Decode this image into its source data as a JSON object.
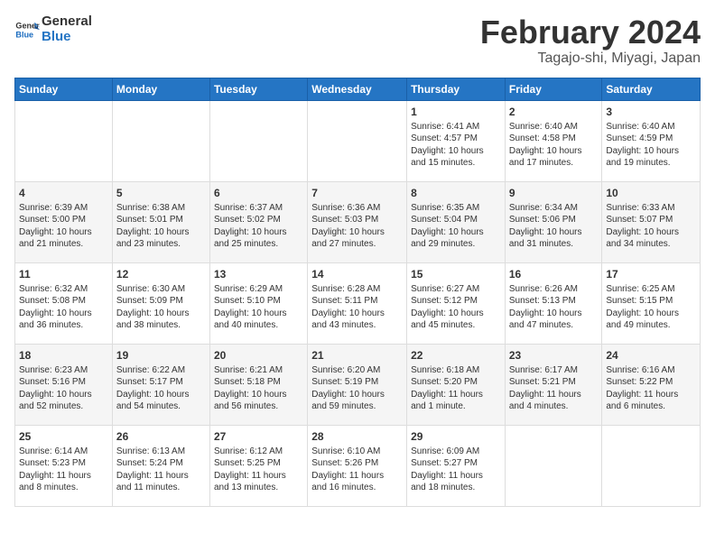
{
  "header": {
    "logo_line1": "General",
    "logo_line2": "Blue",
    "month_title": "February 2024",
    "subtitle": "Tagajo-shi, Miyagi, Japan"
  },
  "weekdays": [
    "Sunday",
    "Monday",
    "Tuesday",
    "Wednesday",
    "Thursday",
    "Friday",
    "Saturday"
  ],
  "weeks": [
    [
      {
        "day": "",
        "info": ""
      },
      {
        "day": "",
        "info": ""
      },
      {
        "day": "",
        "info": ""
      },
      {
        "day": "",
        "info": ""
      },
      {
        "day": "1",
        "info": "Sunrise: 6:41 AM\nSunset: 4:57 PM\nDaylight: 10 hours\nand 15 minutes."
      },
      {
        "day": "2",
        "info": "Sunrise: 6:40 AM\nSunset: 4:58 PM\nDaylight: 10 hours\nand 17 minutes."
      },
      {
        "day": "3",
        "info": "Sunrise: 6:40 AM\nSunset: 4:59 PM\nDaylight: 10 hours\nand 19 minutes."
      }
    ],
    [
      {
        "day": "4",
        "info": "Sunrise: 6:39 AM\nSunset: 5:00 PM\nDaylight: 10 hours\nand 21 minutes."
      },
      {
        "day": "5",
        "info": "Sunrise: 6:38 AM\nSunset: 5:01 PM\nDaylight: 10 hours\nand 23 minutes."
      },
      {
        "day": "6",
        "info": "Sunrise: 6:37 AM\nSunset: 5:02 PM\nDaylight: 10 hours\nand 25 minutes."
      },
      {
        "day": "7",
        "info": "Sunrise: 6:36 AM\nSunset: 5:03 PM\nDaylight: 10 hours\nand 27 minutes."
      },
      {
        "day": "8",
        "info": "Sunrise: 6:35 AM\nSunset: 5:04 PM\nDaylight: 10 hours\nand 29 minutes."
      },
      {
        "day": "9",
        "info": "Sunrise: 6:34 AM\nSunset: 5:06 PM\nDaylight: 10 hours\nand 31 minutes."
      },
      {
        "day": "10",
        "info": "Sunrise: 6:33 AM\nSunset: 5:07 PM\nDaylight: 10 hours\nand 34 minutes."
      }
    ],
    [
      {
        "day": "11",
        "info": "Sunrise: 6:32 AM\nSunset: 5:08 PM\nDaylight: 10 hours\nand 36 minutes."
      },
      {
        "day": "12",
        "info": "Sunrise: 6:30 AM\nSunset: 5:09 PM\nDaylight: 10 hours\nand 38 minutes."
      },
      {
        "day": "13",
        "info": "Sunrise: 6:29 AM\nSunset: 5:10 PM\nDaylight: 10 hours\nand 40 minutes."
      },
      {
        "day": "14",
        "info": "Sunrise: 6:28 AM\nSunset: 5:11 PM\nDaylight: 10 hours\nand 43 minutes."
      },
      {
        "day": "15",
        "info": "Sunrise: 6:27 AM\nSunset: 5:12 PM\nDaylight: 10 hours\nand 45 minutes."
      },
      {
        "day": "16",
        "info": "Sunrise: 6:26 AM\nSunset: 5:13 PM\nDaylight: 10 hours\nand 47 minutes."
      },
      {
        "day": "17",
        "info": "Sunrise: 6:25 AM\nSunset: 5:15 PM\nDaylight: 10 hours\nand 49 minutes."
      }
    ],
    [
      {
        "day": "18",
        "info": "Sunrise: 6:23 AM\nSunset: 5:16 PM\nDaylight: 10 hours\nand 52 minutes."
      },
      {
        "day": "19",
        "info": "Sunrise: 6:22 AM\nSunset: 5:17 PM\nDaylight: 10 hours\nand 54 minutes."
      },
      {
        "day": "20",
        "info": "Sunrise: 6:21 AM\nSunset: 5:18 PM\nDaylight: 10 hours\nand 56 minutes."
      },
      {
        "day": "21",
        "info": "Sunrise: 6:20 AM\nSunset: 5:19 PM\nDaylight: 10 hours\nand 59 minutes."
      },
      {
        "day": "22",
        "info": "Sunrise: 6:18 AM\nSunset: 5:20 PM\nDaylight: 11 hours\nand 1 minute."
      },
      {
        "day": "23",
        "info": "Sunrise: 6:17 AM\nSunset: 5:21 PM\nDaylight: 11 hours\nand 4 minutes."
      },
      {
        "day": "24",
        "info": "Sunrise: 6:16 AM\nSunset: 5:22 PM\nDaylight: 11 hours\nand 6 minutes."
      }
    ],
    [
      {
        "day": "25",
        "info": "Sunrise: 6:14 AM\nSunset: 5:23 PM\nDaylight: 11 hours\nand 8 minutes."
      },
      {
        "day": "26",
        "info": "Sunrise: 6:13 AM\nSunset: 5:24 PM\nDaylight: 11 hours\nand 11 minutes."
      },
      {
        "day": "27",
        "info": "Sunrise: 6:12 AM\nSunset: 5:25 PM\nDaylight: 11 hours\nand 13 minutes."
      },
      {
        "day": "28",
        "info": "Sunrise: 6:10 AM\nSunset: 5:26 PM\nDaylight: 11 hours\nand 16 minutes."
      },
      {
        "day": "29",
        "info": "Sunrise: 6:09 AM\nSunset: 5:27 PM\nDaylight: 11 hours\nand 18 minutes."
      },
      {
        "day": "",
        "info": ""
      },
      {
        "day": "",
        "info": ""
      }
    ]
  ]
}
